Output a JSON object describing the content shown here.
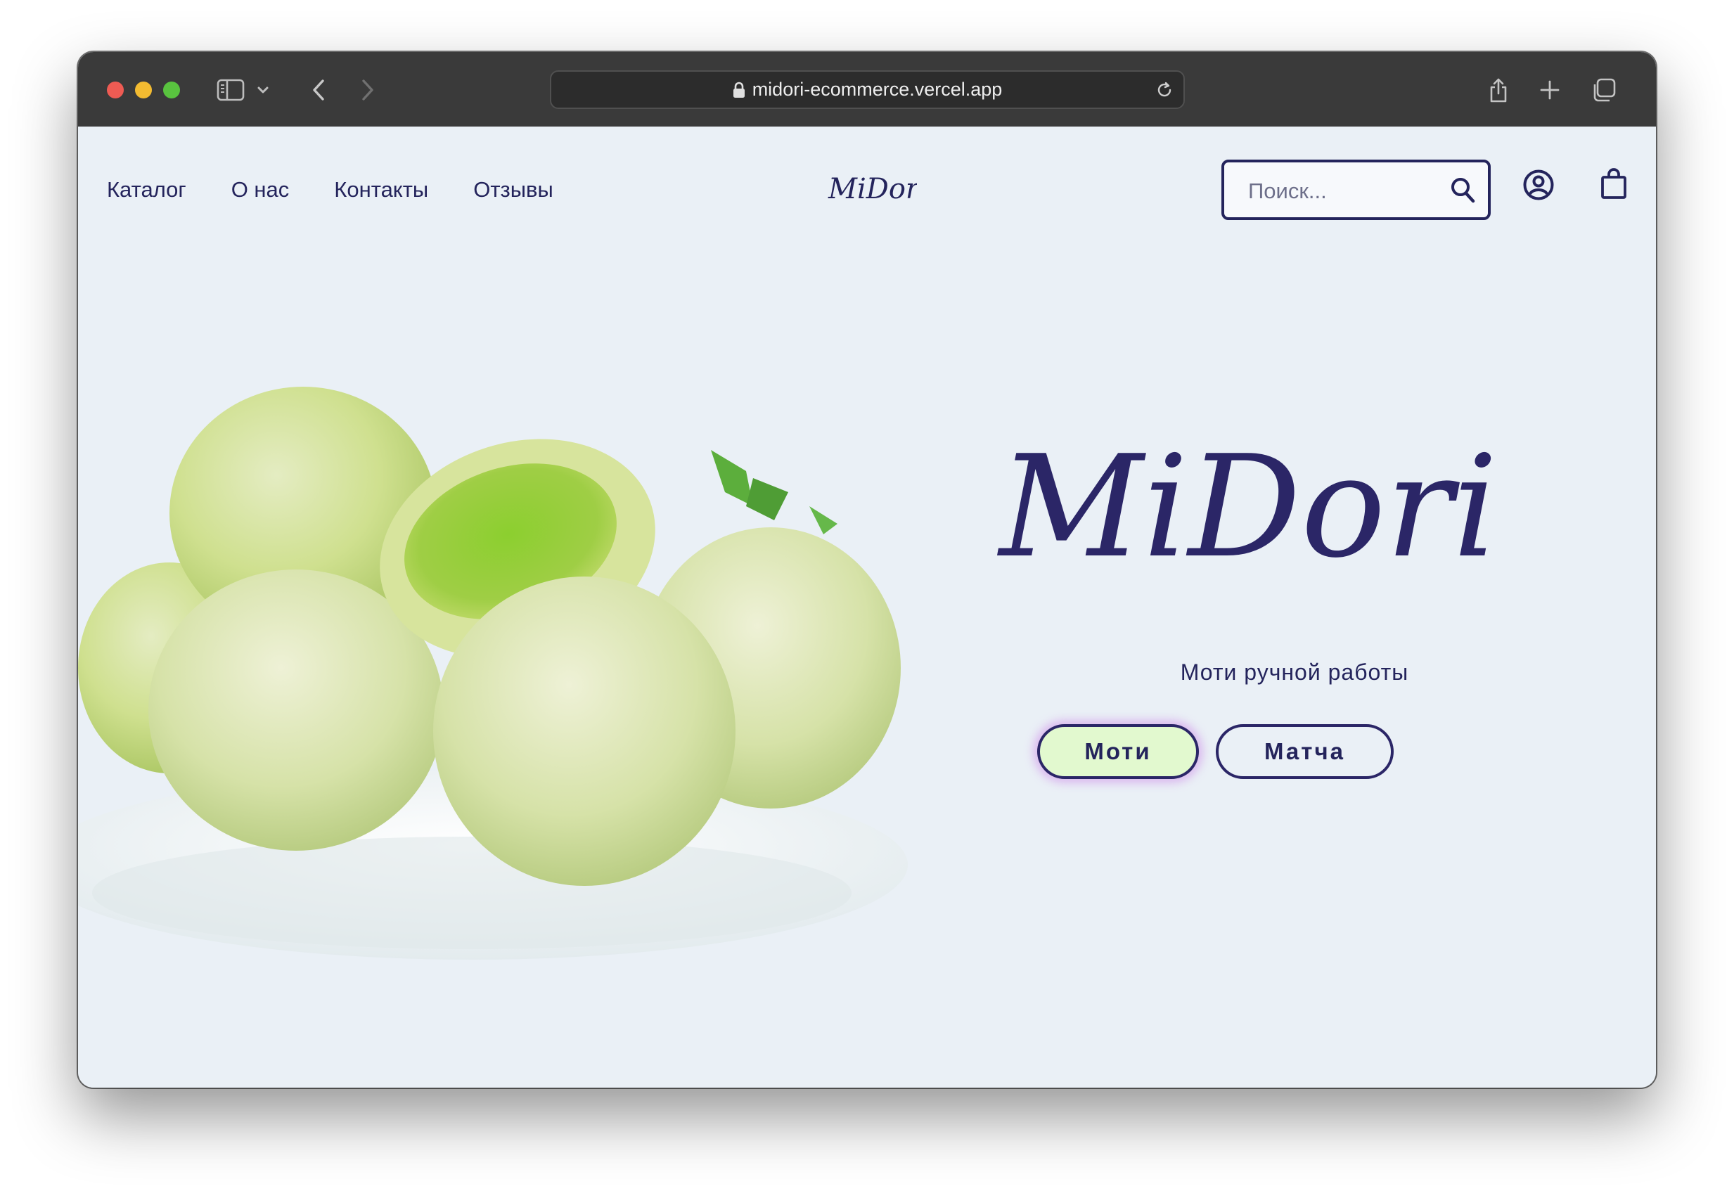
{
  "browser": {
    "url": "midori-ecommerce.vercel.app"
  },
  "nav": {
    "links": [
      "Каталог",
      "О нас",
      "Контакты",
      "Отзывы"
    ],
    "logo": "MiDori",
    "search_placeholder": "Поиск..."
  },
  "hero": {
    "logo": "MiDori",
    "tagline": "Моти ручной работы",
    "buttons": [
      "Моти",
      "Матча"
    ]
  },
  "colors": {
    "brand": "#24245c",
    "page_background": "#eaf0f6",
    "moti_button_fill": "#e2f9cf",
    "moti_button_glow": "#d6aaec"
  },
  "icons": {
    "search": "search-icon",
    "account": "account-icon",
    "cart": "shopping-bag-icon"
  }
}
